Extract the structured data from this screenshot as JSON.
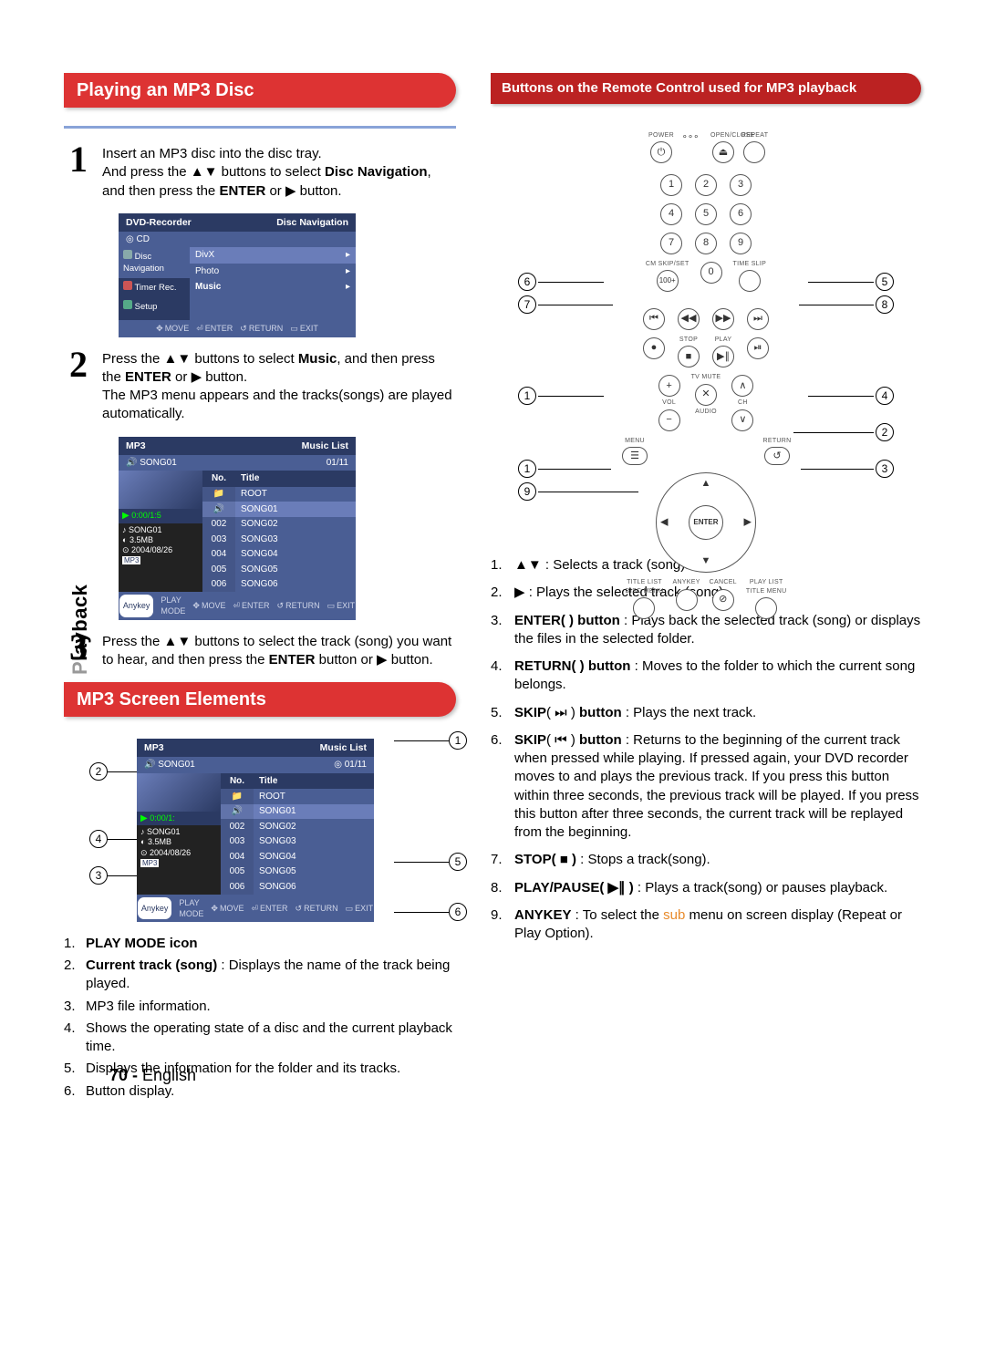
{
  "sideTab": {
    "grey": "P",
    "rest": "layback"
  },
  "headings": {
    "playMp3": "Playing an MP3 Disc",
    "screenElements": "MP3 Screen Elements",
    "remoteButtons": "Buttons on the Remote Control used for MP3 playback"
  },
  "steps": {
    "s1": {
      "num": "1",
      "line1": "Insert an MP3 disc into the disc tray.",
      "line2a": "And press the ",
      "line2b": " buttons to select ",
      "line2c": "Disc Navigation",
      "line2d": ", and then press the ",
      "line2e": "ENTER",
      "line2f": " or ",
      "line2g": " button."
    },
    "s2": {
      "num": "2",
      "line1a": "Press the ",
      "line1b": " buttons to select ",
      "line1c": "Music",
      "line1d": ", and then press the ",
      "line1e": "ENTER",
      "line1f": " or ",
      "line1g": " button.",
      "line2": "The MP3 menu appears and the tracks(songs) are played automatically."
    },
    "s3": {
      "num": "3",
      "line1a": "Press the ",
      "line1b": " buttons to select the track (song) you want to hear, and then press the ",
      "line1c": "ENTER",
      "line1d": " button or ",
      "line1e": " button."
    }
  },
  "arrows": {
    "ud": "▲▼",
    "right": "▶"
  },
  "osd1": {
    "title": "DVD-Recorder",
    "titleRight": "Disc Navigation",
    "sub": "CD",
    "side": [
      "Disc Navigation",
      "Timer Rec.",
      "Setup"
    ],
    "rows": [
      "DivX",
      "Photo",
      "Music"
    ],
    "foot": {
      "move": "MOVE",
      "enter": "ENTER",
      "return": "RETURN",
      "exit": "EXIT"
    }
  },
  "osd2": {
    "title": "MP3",
    "titleRight": "Music List",
    "sub": "SONG01",
    "subRight": "01/11",
    "playbar": "0:00/1:5",
    "meta": {
      "name": "SONG01",
      "size": "3.5MB",
      "date": "2004/08/26",
      "fmt": "MP3"
    },
    "th": {
      "no": "No.",
      "title": "Title"
    },
    "rows": [
      {
        "no": "",
        "title": "ROOT",
        "hl": false,
        "icon": true
      },
      {
        "no": "",
        "title": "SONG01",
        "hl": true,
        "speaker": true
      },
      {
        "no": "002",
        "title": "SONG02"
      },
      {
        "no": "003",
        "title": "SONG03"
      },
      {
        "no": "004",
        "title": "SONG04"
      },
      {
        "no": "005",
        "title": "SONG05"
      },
      {
        "no": "006",
        "title": "SONG06"
      }
    ],
    "foot": {
      "anykey": "Anykey",
      "playmode": "PLAY MODE",
      "move": "MOVE",
      "enter": "ENTER",
      "return": "RETURN",
      "exit": "EXIT"
    }
  },
  "osd3": {
    "playbar": "0:00/1:"
  },
  "screenElementsList": [
    {
      "n": "1.",
      "bold": "PLAY MODE icon",
      "rest": ""
    },
    {
      "n": "2.",
      "bold": "Current track (song)",
      "rest": " : Displays the name of the track being played."
    },
    {
      "n": "3.",
      "bold": "",
      "rest": "MP3 file information."
    },
    {
      "n": "4.",
      "bold": "",
      "rest": "Shows the operating state of a disc and the current playback time."
    },
    {
      "n": "5.",
      "bold": "",
      "rest": "Displays the information for the folder and its tracks."
    },
    {
      "n": "6.",
      "bold": "",
      "rest": "Button display."
    }
  ],
  "remoteLabels": {
    "power": "POWER",
    "open": "OPEN/CLOSE",
    "repeat": "REPEAT",
    "cmskip": "CM SKIP/SET",
    "timeslip": "TIME SLIP",
    "stop": "STOP",
    "play": "PLAY",
    "tvmute": "TV MUTE",
    "vol": "VOL",
    "ch": "CH",
    "audio": "AUDIO",
    "menu": "MENU",
    "return": "RETURN",
    "enter": "ENTER",
    "titlelist": "TITLE LIST",
    "discmenu": "DISC MENU",
    "anykey": "ANYKEY",
    "cancel": "CANCEL",
    "playlist": "PLAY LIST",
    "titlemenu": "TITLE MENU"
  },
  "remoteKeys": {
    "digits": [
      "1",
      "2",
      "3",
      "4",
      "5",
      "6",
      "7",
      "8",
      "9",
      "0"
    ],
    "hundred": "100+",
    "eject": "⏏",
    "skipPrev": "⏮",
    "rew": "◀◀",
    "ffwd": "▶▶",
    "skipNext": "⏭",
    "rec": "●",
    "stop": "■",
    "playpause": "▶∥",
    "step": "⏯",
    "plus": "+",
    "minus": "−",
    "mute": "✕",
    "up": "∧",
    "down": "∨"
  },
  "remoteList": [
    {
      "n": "1.",
      "pre": "",
      "bold": "",
      "icon": "▲▼",
      "post": " : Selects a track (song)."
    },
    {
      "n": "2.",
      "pre": "",
      "bold": "",
      "icon": "▶",
      "post": " : Plays the selected track (song)."
    },
    {
      "n": "3.",
      "pre": "",
      "bold": "ENTER(      ) button",
      "icon": "",
      "post": " : Plays back the selected track (song) or displays the files in the selected folder.",
      "sub": true
    },
    {
      "n": "4.",
      "pre": "",
      "bold": "RETURN(      ) button",
      "icon": "",
      "post": " : Moves to the folder to which the current song belongs."
    },
    {
      "n": "5.",
      "pre": "",
      "bold": "SKIP",
      "icon": "( ⏭ )",
      "boldPost": " button",
      "post": " : Plays the next track."
    },
    {
      "n": "6.",
      "pre": "",
      "bold": "SKIP",
      "icon": "( ⏮ )",
      "boldPost": " button",
      "post": " : Returns to the beginning of the current track when pressed while playing. If pressed again, your DVD recorder moves to and plays the previous track. If you press this button within three seconds, the previous track will be played. If you press this button after three seconds, the current track will be replayed from the beginning.",
      "sub": true
    },
    {
      "n": "7.",
      "pre": "",
      "bold": "STOP( ■ )",
      "icon": "",
      "post": " : Stops a track(song)."
    },
    {
      "n": "8.",
      "pre": "",
      "bold": "PLAY/PAUSE( ▶∥ )",
      "icon": "",
      "post": " : Plays a track(song) or pauses playback."
    },
    {
      "n": "9.",
      "pre": "",
      "bold": "ANYKEY",
      "icon": "",
      "post": " : To select the ",
      "orange": "sub",
      "post2": " menu on screen display (Repeat or Play Option)."
    }
  ],
  "pageFooter": {
    "num": "70 - ",
    "lang": "English"
  },
  "calloutNums": {
    "c1": "1",
    "c2": "2",
    "c3": "3",
    "c4": "4",
    "c5": "5",
    "c6": "6",
    "c7": "7",
    "c8": "8",
    "c9": "9"
  },
  "chart_data": null
}
